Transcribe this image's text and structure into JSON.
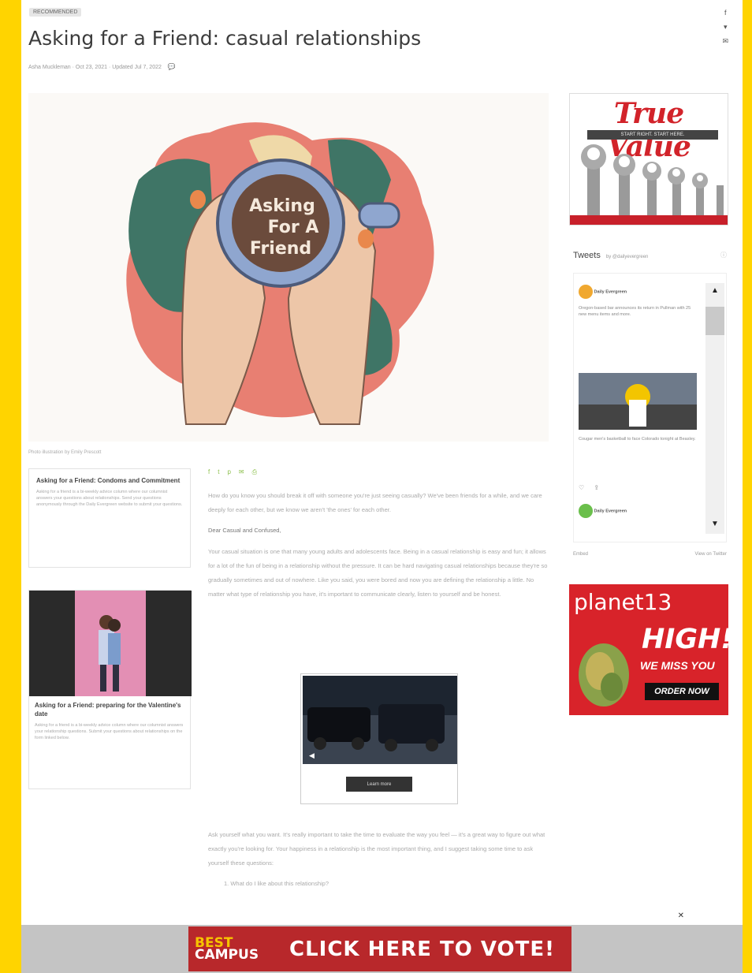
{
  "article": {
    "category": "RECOMMENDED",
    "title": "Asking for a Friend: casual relationships",
    "byline": "Asha Muckleman · Oct 23, 2021 · Updated Jul 7, 2022",
    "photo_caption": "Photo illustration by Emily Prescott",
    "hero_text": [
      "Asking",
      "For A",
      "Friend"
    ],
    "share_icons": [
      "facebook-icon",
      "twitter-icon",
      "pinterest-icon",
      "email-icon",
      "print-icon"
    ],
    "para1": "How do you know you should break it off with someone you're just seeing casually? We've been friends for a while, and we care deeply for each other, but we know we aren't 'the ones' for each other.",
    "subhead": "Dear Casual and Confused,",
    "para2": "Your casual situation is one that many young adults and adolescents face. Being in a casual relationship is easy and fun; it allows for a lot of the fun of being in a relationship without the pressure. It can be hard navigating casual relationships because they're so gradually sometimes and out of nowhere. Like you said, you were bored and now you are defining the relationship a little. No matter what type of relationship you have, it's important to communicate clearly, listen to yourself and be honest.",
    "para3": "Ask yourself what you want. It's really important to take the time to evaluate the way you feel — it's a great way to figure out what exactly you're looking for. Your happiness in a relationship is the most important thing, and I suggest taking some time to ask yourself these questions:",
    "list": [
      "1. What do I like about this relationship?"
    ]
  },
  "related": [
    {
      "title": "Asking for a Friend: Condoms and Commitment",
      "text": "Asking for a friend is a bi-weekly advice column where our columnist answers your questions about relationships. Send your questions anonymously through the Daily Evergreen website to submit your questions."
    },
    {
      "title": "Asking for a Friend: preparing for the Valentine's date",
      "text": "Asking for a friend is a bi-weekly advice column where our columnist answers your relationship questions. Submit your questions about relationships on the form linked below."
    }
  ],
  "video_ad": {
    "button": "Learn more"
  },
  "ads": {
    "truevalue": {
      "logo": "True Value",
      "strap": "START RIGHT. START HERE."
    },
    "planet13": {
      "logo": "planet13",
      "headline": "HIGH!",
      "sub": "WE MISS YOU",
      "cta": "ORDER NOW"
    },
    "bottom": {
      "brand_top": "BEST",
      "brand_bottom": "CAMPUS",
      "cta": "CLICK HERE TO VOTE!"
    }
  },
  "tweets": {
    "header": "Tweets",
    "by": "by @dailyevergreen",
    "items": [
      {
        "name": "Daily Evergreen",
        "text": "Oregon-based bar announces its return in Pullman with 25 new menu items and more."
      },
      {
        "name": "Daily Evergreen",
        "text": "Cougar men's basketball to face Colorado tonight at Beasley."
      }
    ],
    "footer_left": "Embed",
    "footer_right": "View on Twitter"
  },
  "colors": {
    "frame": "#ffd400",
    "accent": "#8bbf4a",
    "truevalue_red": "#d2232a"
  }
}
